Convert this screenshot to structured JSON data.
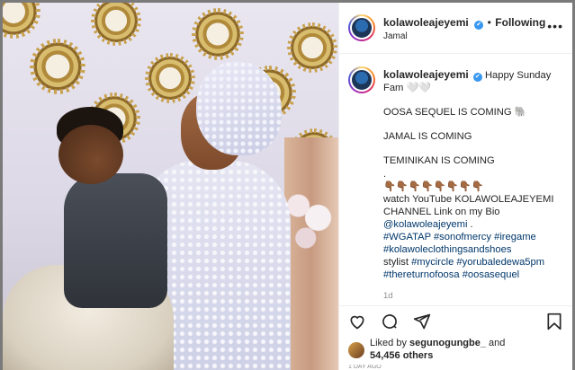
{
  "post": {
    "username": "kolawoleajeyemi",
    "verified_mark": "✔",
    "separator": "•",
    "follow_state": "Following",
    "location": "Jamal",
    "more_label": "•••"
  },
  "caption": {
    "username": "kolawoleajeyemi",
    "lines": {
      "l1": "Happy Sunday Fam 🤍🤍",
      "l2": "OOSA SEQUEL IS COMING 🐘",
      "l3": "JAMAL IS COMING",
      "l4": "TEMINIKAN IS COMING",
      "l5": ".",
      "l6": "👇🏾👇🏾👇🏾👇🏾👇🏾👇🏾👇🏾👇🏾",
      "l7": "watch YouTube KOLAWOLEAJEYEMI CHANNEL Link on my Bio",
      "l8": "@kolawoleajeyemi",
      "l8b": " .",
      "l9": "#WGATAP #sonofmercy #iregame #kolawoleclothingsandshoes",
      "l10a": "stylist ",
      "l10b": "#mycircle #yorubaledewa5pm #thereturnofoosa #oosasequel"
    },
    "time": "1d"
  },
  "likes": {
    "prefix": "Liked by ",
    "user": "segunogungbe_",
    "and": " and",
    "count": "54,456 others"
  },
  "footer": {
    "text": "1 DAY AGO"
  },
  "icons": [
    "heart-icon",
    "comment-icon",
    "share-icon",
    "bookmark-icon",
    "verified-icon",
    "more-icon"
  ],
  "colors": {
    "link": "#00376b",
    "verified": "#3897f0",
    "text": "#262626",
    "muted": "#8e8e8e"
  }
}
